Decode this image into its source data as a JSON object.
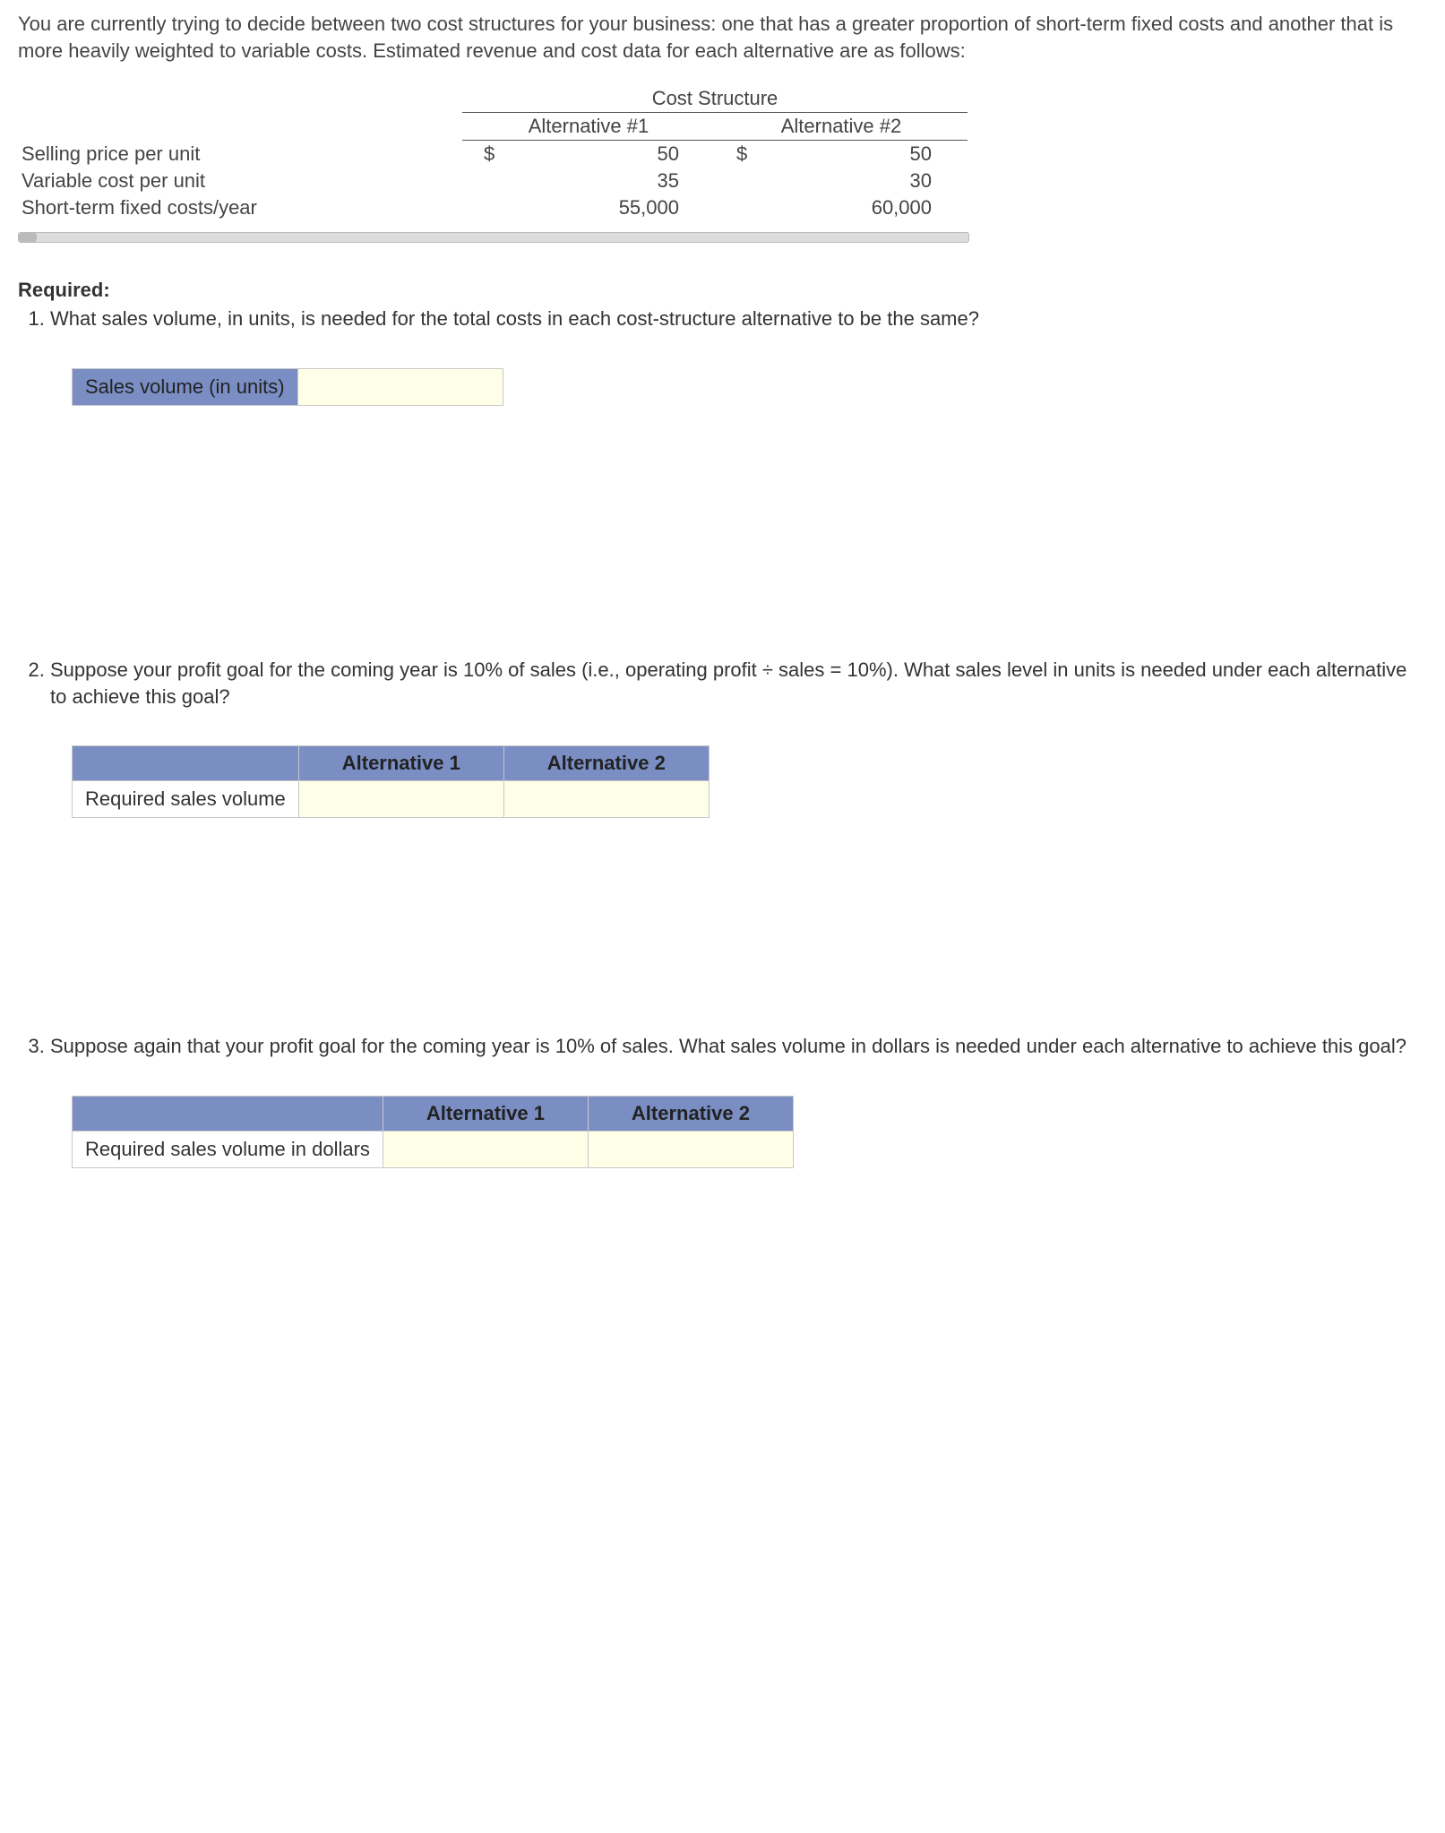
{
  "intro": "You are currently trying to decide between two cost structures for your business: one that has a greater proportion of short-term fixed costs and another that is more heavily weighted to variable costs. Estimated revenue and cost data for each alternative are as follows:",
  "data_table": {
    "group_header": "Cost Structure",
    "col1": "Alternative #1",
    "col2": "Alternative #2",
    "rows": [
      {
        "label": "Selling price per unit",
        "sym1": "$",
        "v1": "50",
        "sym2": "$",
        "v2": "50"
      },
      {
        "label": "Variable cost per unit",
        "sym1": "",
        "v1": "35",
        "sym2": "",
        "v2": "30"
      },
      {
        "label": "Short-term fixed costs/year",
        "sym1": "",
        "v1": "55,000",
        "sym2": "",
        "v2": "60,000"
      }
    ]
  },
  "required_label": "Required:",
  "q1": {
    "text": "What sales volume, in units, is needed for the total costs in each cost-structure alternative to be the same?",
    "row_label": "Sales volume (in units)",
    "value": ""
  },
  "q2": {
    "text": "Suppose your profit goal for the coming year is 10% of sales (i.e., operating profit ÷ sales = 10%). What sales level in units is needed under each alternative to achieve this goal?",
    "col1": "Alternative 1",
    "col2": "Alternative 2",
    "row_label": "Required sales volume",
    "v1": "",
    "v2": ""
  },
  "q3": {
    "text": "Suppose again that your profit goal for the coming year is 10% of sales. What sales volume in dollars is needed under each alternative to achieve this goal?",
    "col1": "Alternative 1",
    "col2": "Alternative 2",
    "row_label": "Required sales volume in dollars",
    "v1": "",
    "v2": ""
  }
}
